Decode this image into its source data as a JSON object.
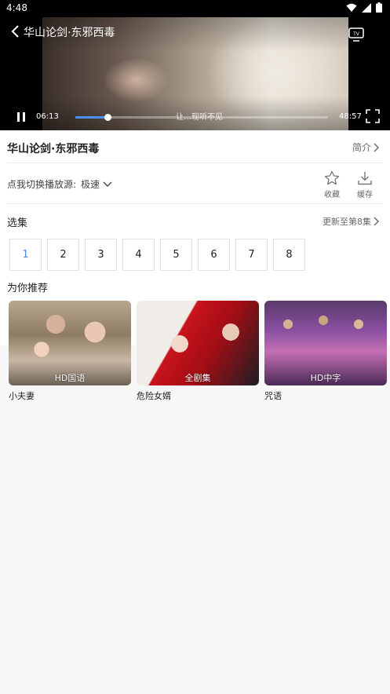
{
  "status_bar": {
    "time": "4:48"
  },
  "player": {
    "title": "华山论剑·东邪西毒",
    "current_time": "06:13",
    "total_time": "48:57",
    "subtitle": "让…现听不见",
    "progress_fraction": 0.127
  },
  "info": {
    "show_title": "华山论剑·东邪西毒",
    "intro_label": "简介",
    "source_label": "点我切换播放源:",
    "source_value": "极速",
    "favorite_label": "收藏",
    "download_label": "缓存"
  },
  "episodes": {
    "title": "选集",
    "update_label": "更新至第8集",
    "items": [
      "1",
      "2",
      "3",
      "4",
      "5",
      "6",
      "7",
      "8"
    ],
    "active_index": 0
  },
  "recommend": {
    "title": "为你推荐",
    "items": [
      {
        "name": "小夫妻",
        "badge": "HD国语"
      },
      {
        "name": "危险女婿",
        "badge": "全剧集"
      },
      {
        "name": "咒语",
        "badge": "HD中字"
      }
    ]
  },
  "colors": {
    "accent": "#4d8ef7"
  }
}
